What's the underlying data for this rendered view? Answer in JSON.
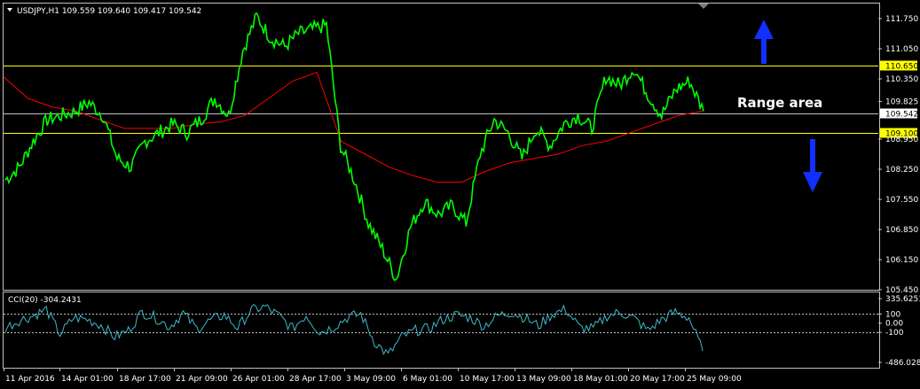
{
  "header": {
    "symbol_line": "USDJPY,H1  109.559 109.640 109.417 109.542"
  },
  "annotation": {
    "range_label": "Range area"
  },
  "indicator": {
    "label": "CCI(20) -304.2431"
  },
  "colors": {
    "background": "#000000",
    "frame": "#c0c0c0",
    "price": "#00ff00",
    "ma": "#ff0000",
    "level_line": "#ffff00",
    "current_line": "#c0c0c0",
    "cci": "#3fb8c8",
    "arrow": "#1030ff"
  },
  "chart_data": [
    {
      "type": "line",
      "title": "USDJPY,H1",
      "ylim": [
        105.45,
        112.1
      ],
      "y_ticks": [
        "111.750",
        "111.050",
        "110.350",
        "109.825",
        "108.950",
        "108.250",
        "107.550",
        "106.850",
        "106.150",
        "105.450"
      ],
      "x_ticks": [
        "11 Apr 2016",
        "14 Apr 01:00",
        "18 Apr 17:00",
        "21 Apr 09:00",
        "26 Apr 01:00",
        "28 Apr 17:00",
        "3 May 09:00",
        "6 May 01:00",
        "10 May 17:00",
        "13 May 09:00",
        "18 May 01:00",
        "20 May 17:00",
        "25 May 09:00"
      ],
      "levels": [
        {
          "name": "resistance",
          "value": 110.65,
          "label": "110.650"
        },
        {
          "name": "support",
          "value": 109.1,
          "label": "109.100"
        }
      ],
      "current_price": {
        "value": 109.542,
        "label": "109.542"
      },
      "series": [
        {
          "values": [
            108.0,
            108.3,
            108.9,
            109.4,
            109.5,
            109.6,
            109.8,
            109.5,
            108.5,
            108.3,
            108.9,
            109.1,
            109.3,
            109.1,
            109.4,
            109.9,
            109.5,
            111.0,
            111.8,
            111.3,
            111.1,
            111.4,
            111.5,
            111.6,
            108.8,
            108.0,
            107.0,
            106.4,
            105.7,
            106.9,
            107.5,
            107.2,
            107.4,
            107.0,
            108.6,
            109.4,
            109.1,
            108.5,
            109.2,
            108.8,
            109.3,
            109.5,
            109.2,
            110.4,
            110.2,
            110.6,
            110.0,
            109.5,
            110.1,
            110.3,
            109.6
          ]
        },
        {
          "values": [
            110.4,
            109.9,
            109.7,
            109.6,
            109.4,
            109.2,
            109.2,
            109.2,
            109.3,
            109.35,
            109.5,
            109.9,
            110.3,
            110.5,
            108.9,
            108.6,
            108.3,
            108.1,
            107.95,
            107.95,
            108.2,
            108.4,
            108.5,
            108.6,
            108.8,
            108.9,
            109.1,
            109.3,
            109.5,
            109.6
          ]
        }
      ]
    },
    {
      "type": "line",
      "title": "CCI(20) -304.2431",
      "ylim": [
        -486.0281,
        335.6251
      ],
      "y_ticks": [
        "335.6251",
        "100",
        "0.00",
        "-100",
        "-486.0281"
      ],
      "reference_lines": [
        100,
        -100
      ],
      "series": [
        {
          "values": [
            -50,
            30,
            80,
            150,
            -120,
            60,
            40,
            -20,
            -150,
            -80,
            120,
            60,
            -40,
            110,
            -60,
            30,
            90,
            -50,
            140,
            180,
            80,
            -60,
            90,
            -100,
            -40,
            60,
            100,
            -200,
            -350,
            -150,
            -80,
            -60,
            40,
            90,
            60,
            -30,
            80,
            120,
            60,
            -30,
            100,
            150,
            -50,
            -60,
            80,
            120,
            50,
            -80,
            40,
            120,
            60,
            -304
          ]
        }
      ]
    }
  ]
}
